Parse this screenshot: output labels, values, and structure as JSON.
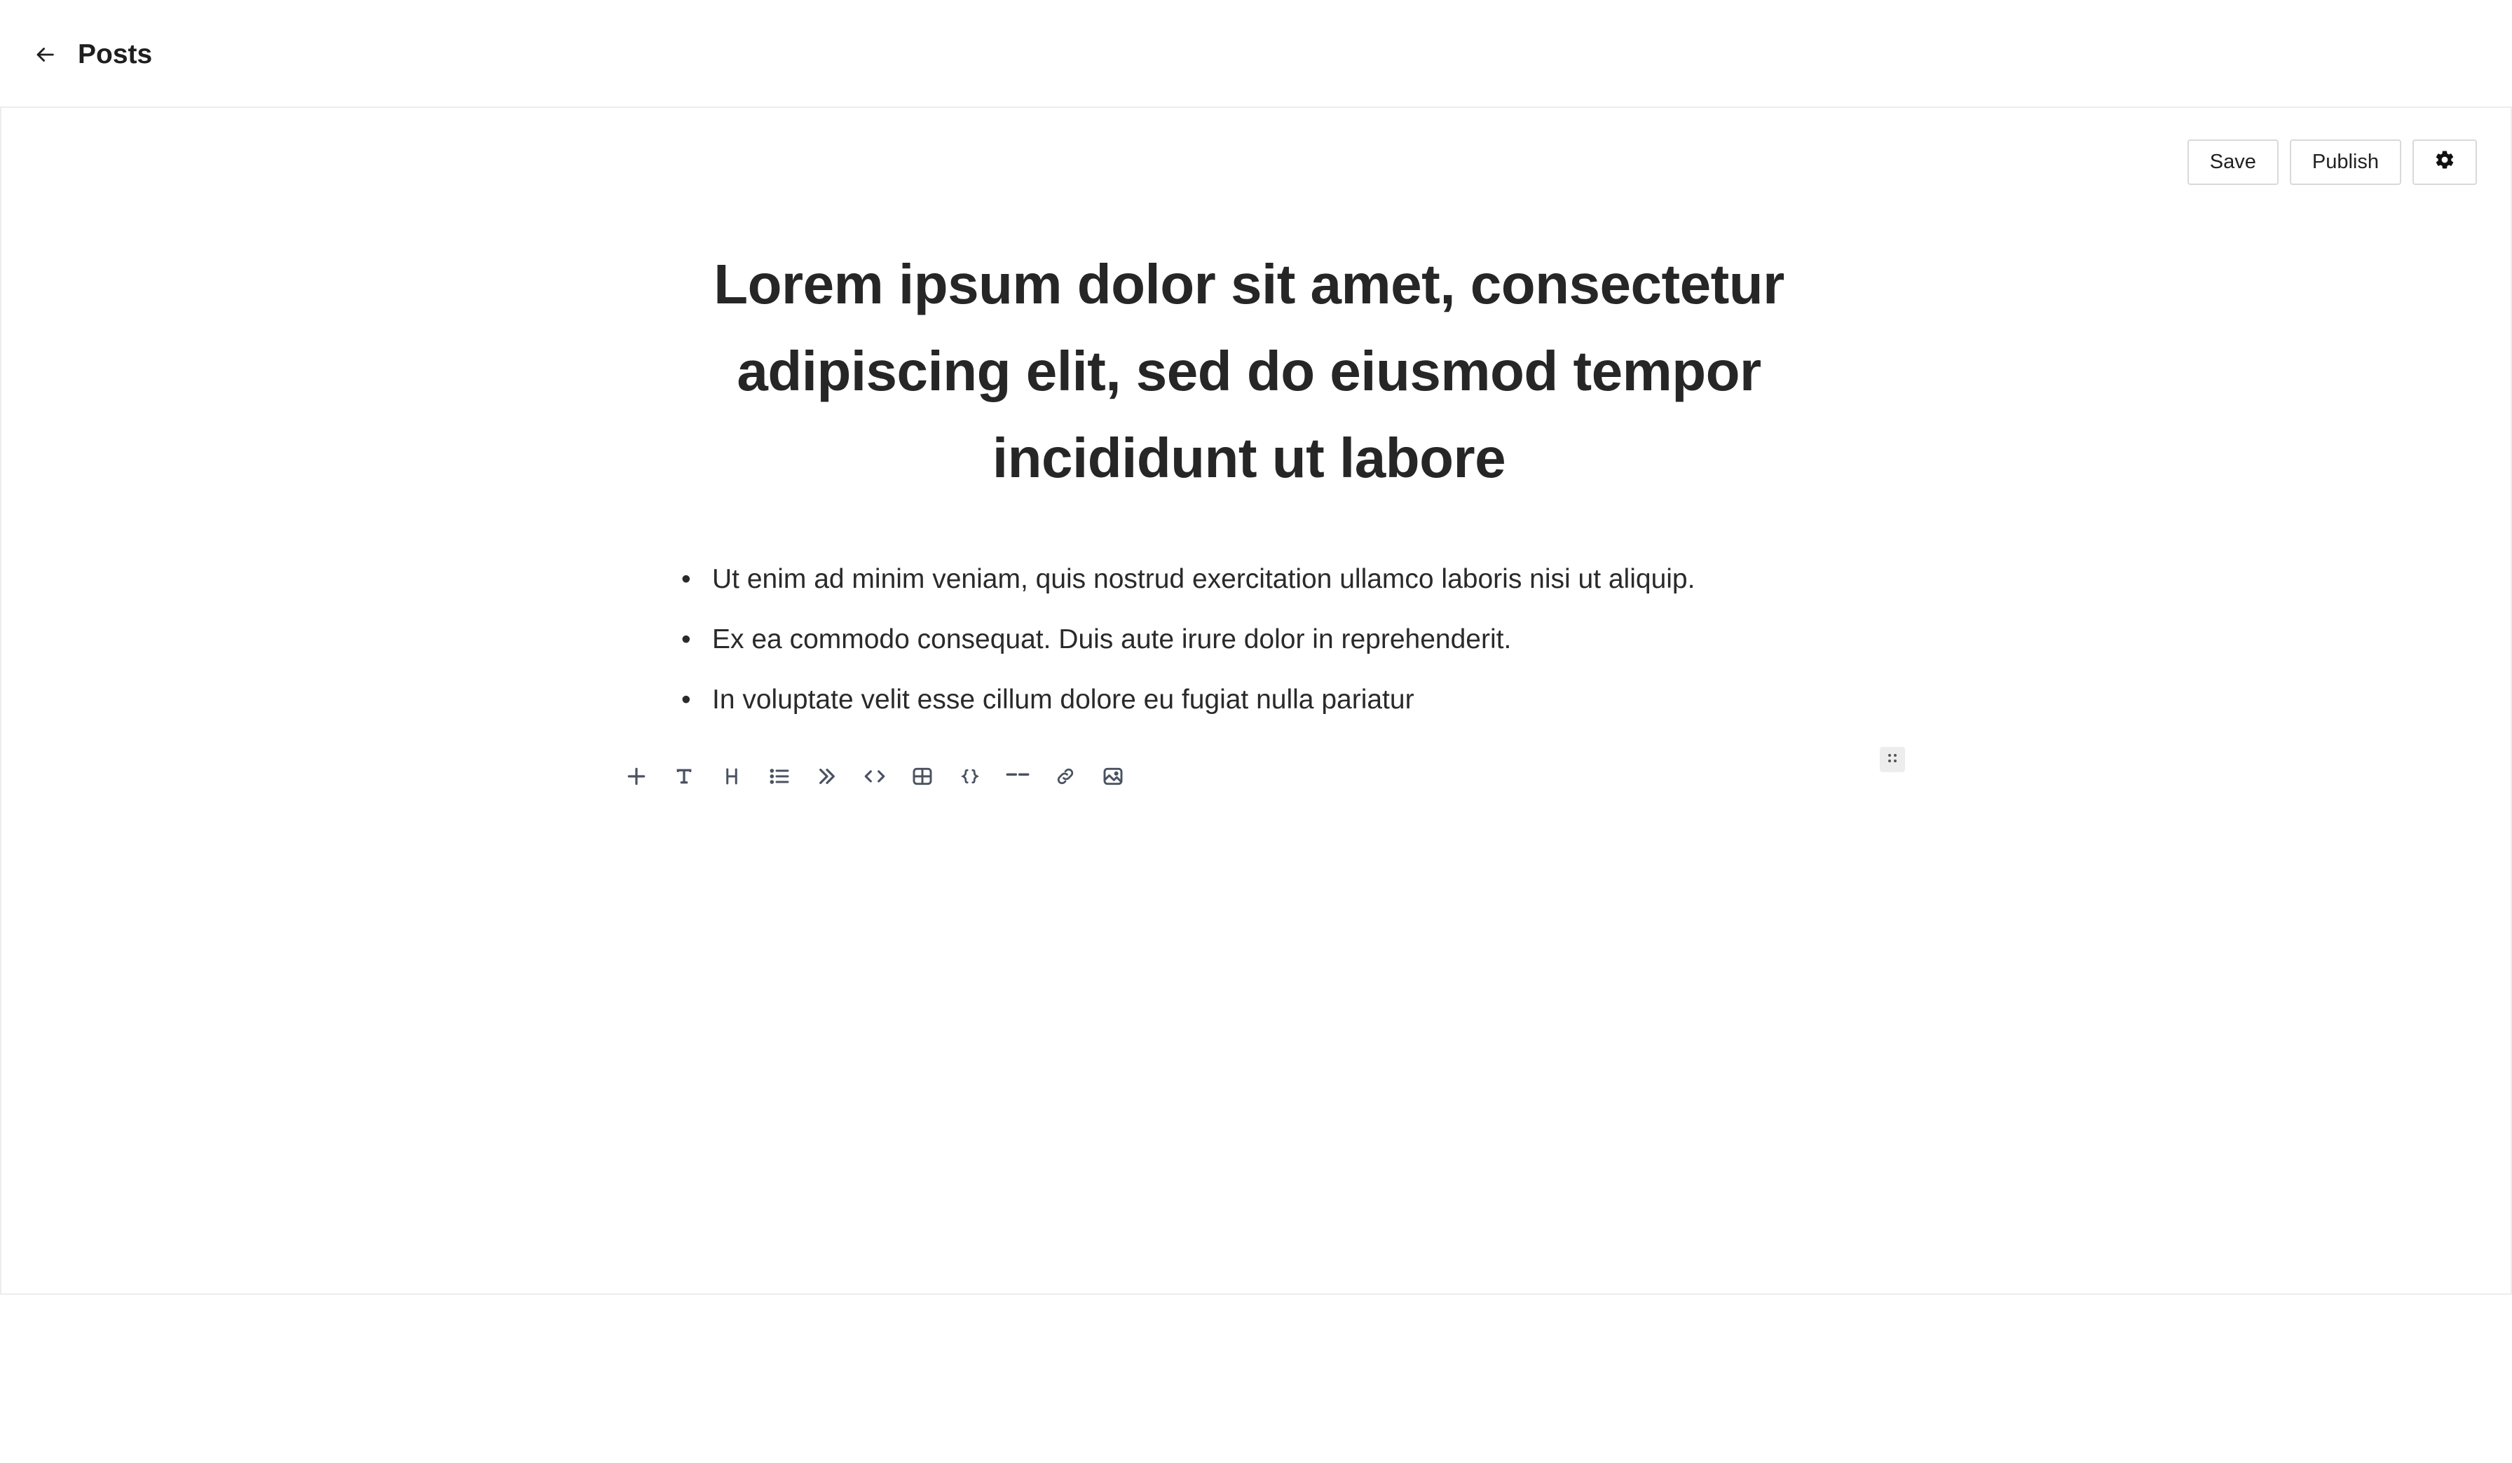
{
  "header": {
    "title": "Posts",
    "back_icon": "arrow-left-icon"
  },
  "actions": {
    "save_label": "Save",
    "publish_label": "Publish",
    "settings_icon": "gear-icon"
  },
  "post": {
    "title": "Lorem ipsum dolor sit amet, consectetur adipiscing elit, sed do eiusmod tempor incididunt ut labore",
    "bullets": [
      "Ut enim ad minim veniam, quis nostrud exercitation ullamco laboris nisi ut aliquip.",
      " Ex ea commodo consequat. Duis aute irure dolor in reprehenderit.",
      " In voluptate velit esse cillum dolore eu fugiat nulla pariatur"
    ]
  },
  "toolbar": {
    "tools": [
      "plus-icon",
      "text-icon",
      "heading-icon",
      "list-icon",
      "quote-icon",
      "code-icon",
      "table-icon",
      "code-block-icon",
      "divider-icon",
      "link-icon",
      "image-icon"
    ]
  },
  "colors": {
    "text": "#1f1f1f",
    "icon": "#4a5261",
    "border": "#d9d9d9"
  }
}
